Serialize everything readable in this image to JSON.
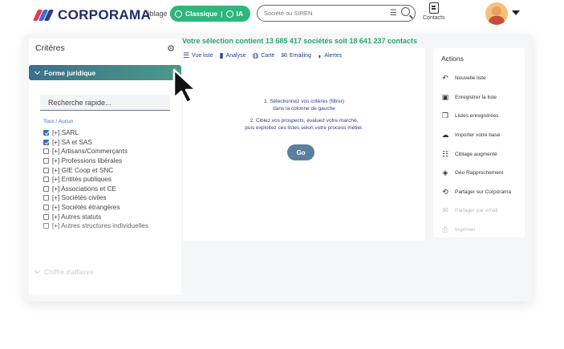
{
  "header": {
    "logo_text": "CORPORAMA",
    "ciblage_label": "Ciblage :",
    "mode_classique": "Classique",
    "mode_separator": "|",
    "mode_ia": "IA",
    "search_placeholder": "Société ou SIREN",
    "contacts_label": "Contacts"
  },
  "banner": "Votre sélection contient 13 685 417 sociétés soit 18 641 237 contacts",
  "criteria": {
    "title": "Critères",
    "section_forme": "Forme juridique",
    "quick_search": "Recherche rapide...",
    "tous_aucun": "Tous / Aucun",
    "options": [
      {
        "label": "[+] SARL",
        "checked": true
      },
      {
        "label": "[+] SA et SAS",
        "checked": true
      },
      {
        "label": "[+] Artisans/Commerçants",
        "checked": false
      },
      {
        "label": "[+] Professions libérales",
        "checked": false
      },
      {
        "label": "[+] GIE Coop et SNC",
        "checked": false
      },
      {
        "label": "[+] Entités publiques",
        "checked": false
      },
      {
        "label": "[+] Associations et CE",
        "checked": false
      },
      {
        "label": "[+] Sociétés civiles",
        "checked": false
      },
      {
        "label": "[+] Sociétés étrangères",
        "checked": false
      },
      {
        "label": "[+] Autres statuts",
        "checked": false
      },
      {
        "label": "[+] Autres structures individuelles",
        "checked": false
      }
    ],
    "section_ca": "Chiffre d'affaires"
  },
  "views": {
    "liste": "Vue liste",
    "analyse": "Analyse",
    "carte": "Carte",
    "emailing": "Emailing",
    "alertes": "Alertes"
  },
  "center": {
    "step1_title": "1. Sélectionnez vos critères (filtrer)",
    "step1_sub": "dans la colonne de gauche",
    "step2_title": "2. Ciblez vos prospects, évaluez votre marché,",
    "step2_sub": "puis exploitez ces listes selon votre process métier.",
    "go_label": "Go"
  },
  "actions": {
    "title": "Actions",
    "items": [
      {
        "label": "Nouvelle liste",
        "icon": "undo-icon",
        "enabled": true
      },
      {
        "label": "Enregistrer la liste",
        "icon": "save-icon",
        "enabled": true
      },
      {
        "label": "Listes enregistrées",
        "icon": "copy-icon",
        "enabled": true
      },
      {
        "label": "Importer votre base",
        "icon": "upload-cloud-icon",
        "enabled": true
      },
      {
        "label": "Ciblage augmenté",
        "icon": "sliders-icon",
        "enabled": true
      },
      {
        "label": "Géo Rapprochement",
        "icon": "diamond-icon",
        "enabled": true
      },
      {
        "label": "Partager sur Corporama",
        "icon": "share-icon",
        "enabled": true
      },
      {
        "label": "Partager par email",
        "icon": "mail-icon",
        "enabled": false
      },
      {
        "label": "Imprimer",
        "icon": "printer-icon",
        "enabled": false
      }
    ]
  },
  "colors": {
    "accent_green": "#2fb67e",
    "brand_navy": "#1f2d6b",
    "link_blue": "#3a6fb8",
    "header_teal": "#3d6f8a"
  }
}
